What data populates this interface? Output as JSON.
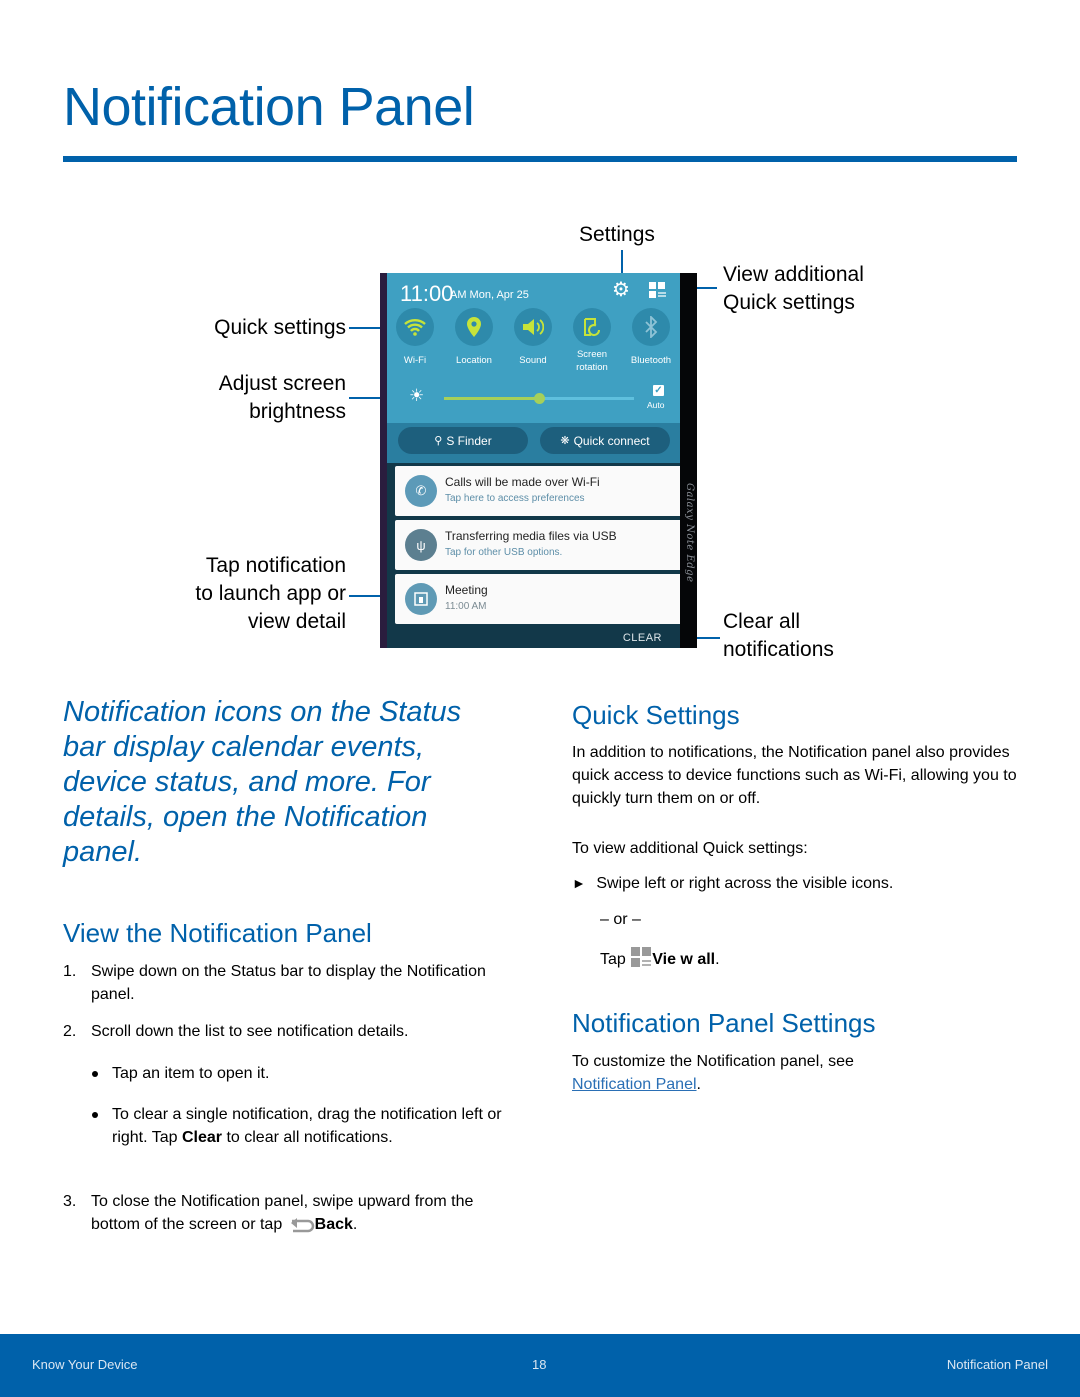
{
  "page": {
    "title": "Notification Panel"
  },
  "callouts": {
    "settings": "Settings",
    "view_additional": [
      "View additional",
      "Quick settings"
    ],
    "quick_settings": "Quick settings",
    "adjust_brightness": [
      "Adjust screen",
      "brightness"
    ],
    "tap_notification": [
      "Tap notification",
      "to launch app or",
      "view detail"
    ],
    "clear_all": [
      "Clear all",
      "notifications"
    ]
  },
  "phone": {
    "time": "11:00",
    "date": "AM Mon, Apr 25",
    "edge_label": "Galaxy Note Edge",
    "quick_settings": [
      {
        "label": "Wi-Fi",
        "icon": "wifi-icon",
        "active": true
      },
      {
        "label": "Location",
        "icon": "location-icon",
        "active": true
      },
      {
        "label": "Sound",
        "icon": "sound-icon",
        "active": true
      },
      {
        "label": "Screen rotation",
        "icon": "screen-rotation-icon",
        "active": true
      },
      {
        "label": "Bluetooth",
        "icon": "bluetooth-icon",
        "active": false
      }
    ],
    "brightness_level": 0.5,
    "auto_label": "Auto",
    "auto_checked": true,
    "s_finder_label": "S Finder",
    "quick_connect_label": "Quick connect",
    "notifications": [
      {
        "title": "Calls will be made over Wi-Fi",
        "subtitle": "Tap here to access preferences",
        "icon": "wifi-calling-icon"
      },
      {
        "title": "Transferring media files via USB",
        "subtitle": "Tap for other USB options.",
        "icon": "usb-icon"
      },
      {
        "title": "Meeting",
        "subtitle": "11:00 AM",
        "icon": "calendar-icon"
      }
    ],
    "clear_label": "CLEAR"
  },
  "intro": "Notification icons on the Status bar display calendar events, device status, and more. For details, open the Notification panel.",
  "view_section": {
    "heading": "View the Notification Panel",
    "step1_num": "1.",
    "step1": "Swipe down on the Status bar to display the Notification panel.",
    "step2_num": "2.",
    "step2": "Scroll down the list to see notification details.",
    "bullet1": "Tap an item to open it.",
    "bullet2_pre": "To clear a single notification, drag the notification left or right. Tap ",
    "bullet2_bold": "Clear",
    "bullet2_post": " to clear all notifications.",
    "step3_num": "3.",
    "step3_pre": "To close the Notification panel, swipe upward from the bottom of the screen or tap ",
    "step3_bold": "Back",
    "step3_post": "."
  },
  "quick_section": {
    "heading": "Quick Settings",
    "para": "In addition to notifications, the Notification panel also provides quick access to device functions such as Wi-Fi, allowing you to quickly turn them on or off.",
    "to_view": "To view additional Quick settings:",
    "arrow_item": "Swipe left or right across the visible icons.",
    "or": "– or –",
    "tap_pre": "Tap ",
    "tap_bold": "Vie w all",
    "tap_post": "."
  },
  "settings_section": {
    "heading": "Notification Panel Settings",
    "para": "To customize the Notification panel, see",
    "link": "Notification Panel",
    "link_post": "."
  },
  "footer": {
    "left": "Know Your Device",
    "page_number": "18",
    "right": "Notification Panel"
  },
  "colors": {
    "brand_blue": "#0061aa",
    "phone_blue": "#3fa0c2",
    "slider_green": "#a6d05a"
  }
}
